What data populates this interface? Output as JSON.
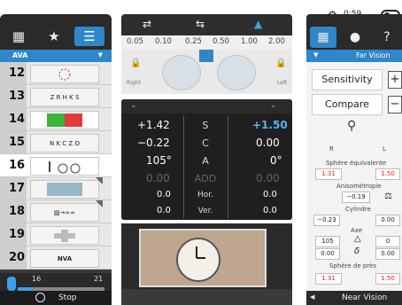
{
  "status": {
    "timer": "0:59"
  },
  "left_panel": {
    "chart_set": "AVA",
    "rows": [
      {
        "num": "12",
        "thumb": ""
      },
      {
        "num": "13",
        "thumb": "Z R H K S"
      },
      {
        "num": "14",
        "thumb": ""
      },
      {
        "num": "15",
        "thumb": "N K C Z O"
      },
      {
        "num": "16",
        "thumb": ""
      },
      {
        "num": "17",
        "thumb": ""
      },
      {
        "num": "18",
        "thumb": "▨→∞∞"
      },
      {
        "num": "19",
        "thumb": ""
      },
      {
        "num": "20",
        "thumb": "NVA"
      }
    ],
    "slider": {
      "min": "16",
      "max": "21"
    },
    "stop_label": "Stop"
  },
  "scale": {
    "ticks": [
      "0.05",
      "0.10",
      "0.25",
      "0.50",
      "1.00",
      "2.00"
    ]
  },
  "phoropter": {
    "right_label": "Right",
    "left_label": "Left"
  },
  "values": {
    "rows": [
      {
        "r": "+1.42",
        "label": "S",
        "l": "+1.50"
      },
      {
        "r": "−0.22",
        "label": "C",
        "l": "0.00"
      },
      {
        "r": "105°",
        "label": "A",
        "l": "0°"
      },
      {
        "r": "0.00",
        "label": "ADD",
        "l": "0.00"
      },
      {
        "r": "0.0",
        "label": "Hor.",
        "l": "0.0"
      },
      {
        "r": "0.0",
        "label": "Ver.",
        "l": "0.0"
      }
    ]
  },
  "right_panel": {
    "title": "Far Vision",
    "sensitivity_label": "Sensitivity",
    "compare_label": "Compare",
    "r_label": "R",
    "l_label": "L",
    "sphere_equiv_label": "Sphère équivalente",
    "sphere_equiv_r": "1.31",
    "sphere_equiv_l": "1.50",
    "aniso_label": "Anisométropie",
    "aniso_value": "−0.19",
    "cyl_label": "Cylindre",
    "cyl_r": "−0.23",
    "cyl_l": "0.00",
    "axe_label": "Axe",
    "axe_r": "105",
    "axe_l": "0",
    "delta_r": "0.00",
    "delta_l": "0.00",
    "near_sphere_label": "Sphère de près",
    "near_sphere_r": "1.31",
    "near_sphere_l": "1.50",
    "near_vision_label": "Near Vision"
  }
}
